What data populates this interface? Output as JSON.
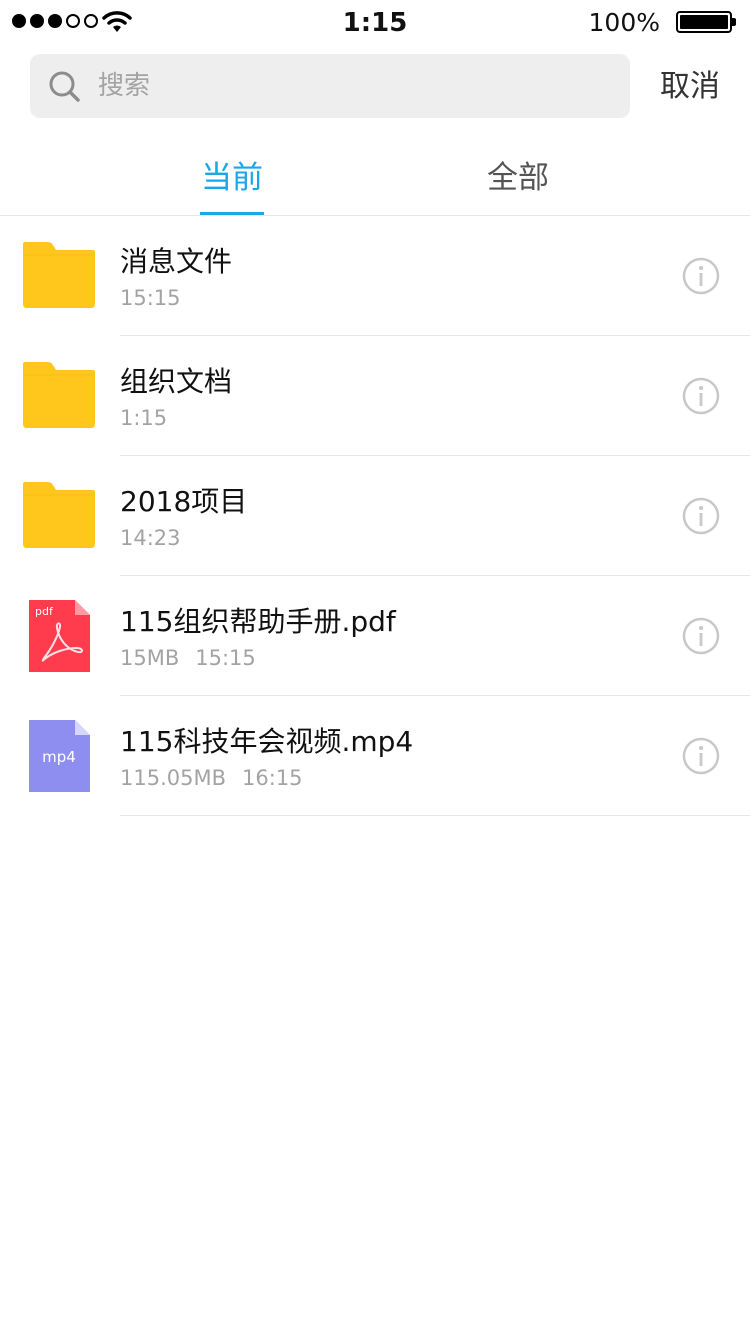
{
  "status_bar": {
    "time": "1:15",
    "battery": "100%"
  },
  "search": {
    "placeholder": "搜索",
    "value": "",
    "cancel_label": "取消"
  },
  "tabs": {
    "items": [
      {
        "label": "当前",
        "active": true
      },
      {
        "label": "全部",
        "active": false
      }
    ],
    "active_color": "#1ba6e8"
  },
  "files": [
    {
      "name": "消息文件",
      "meta": [
        "15:15"
      ],
      "icon": "folder-icon"
    },
    {
      "name": "组织文档",
      "meta": [
        "1:15"
      ],
      "icon": "folder-icon"
    },
    {
      "name": "2018项目",
      "meta": [
        "14:23"
      ],
      "icon": "folder-icon"
    },
    {
      "name": "115组织帮助手册.pdf",
      "meta": [
        "15MB",
        "15:15"
      ],
      "icon": "pdf-file-icon",
      "badge": "pdf"
    },
    {
      "name": "115科技年会视频.mp4",
      "meta": [
        "115.05MB",
        "16:15"
      ],
      "icon": "mp4-file-icon",
      "badge": "mp4"
    }
  ],
  "colors": {
    "folder": "#ffc61b",
    "pdf": "#ff3b4e",
    "mp4": "#8e8ef0",
    "accent": "#1ba6e8"
  }
}
